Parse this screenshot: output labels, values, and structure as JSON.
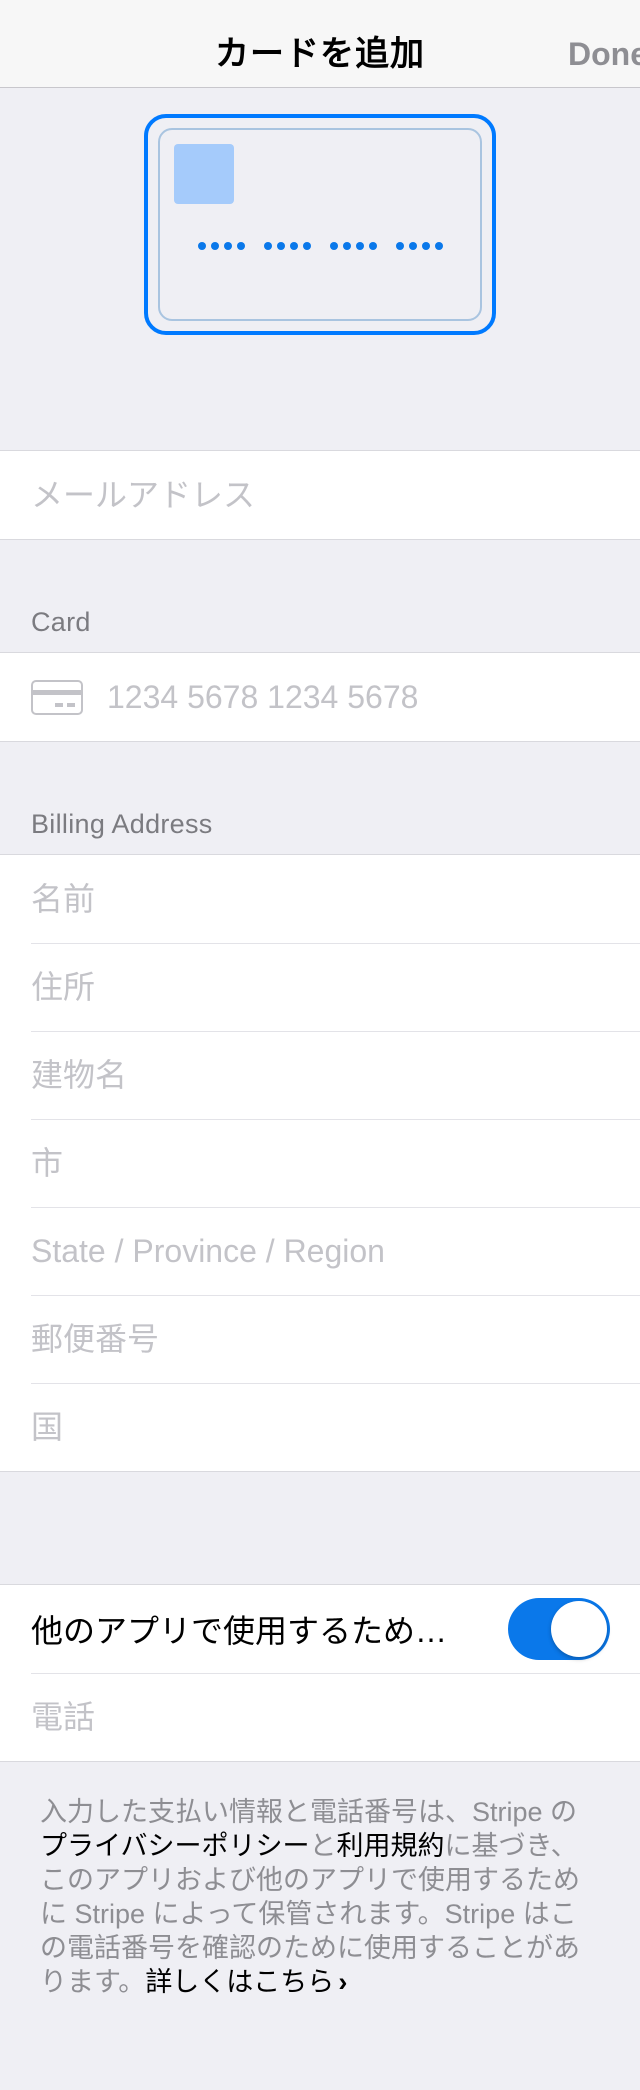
{
  "nav": {
    "title": "カードを追加",
    "done_label": "Done"
  },
  "email": {
    "placeholder": "メールアドレス"
  },
  "card_section": {
    "header": "Card",
    "number_placeholder": "1234 5678 1234 5678"
  },
  "billing": {
    "header": "Billing Address",
    "fields": [
      {
        "placeholder": "名前"
      },
      {
        "placeholder": "住所"
      },
      {
        "placeholder": "建物名"
      },
      {
        "placeholder": "市"
      },
      {
        "placeholder": "State / Province / Region"
      },
      {
        "placeholder": "郵便番号"
      },
      {
        "placeholder": "国"
      }
    ]
  },
  "save": {
    "toggle_label": "他のアプリで使用するため…",
    "toggle_on": true,
    "phone_placeholder": "電話"
  },
  "footer": {
    "text_1": "入力した支払い情報と電話番号は、Stripe の",
    "privacy_link": "プライバシーポリシー",
    "text_2": "と",
    "terms_link": "利用規約",
    "text_3": "に基づき、このアプリおよび他のアプリで使用するために Stripe によって保管されます。Stripe はこの電話番号を確認のために使用することがあります。",
    "learn_more_link": "詳しくはこちら"
  },
  "colors": {
    "accent": "#007aff",
    "background": "#efeff4",
    "placeholder": "#c3c3c8"
  },
  "icons": {
    "card": "credit-card-icon",
    "chevron": "chevron-right-icon"
  }
}
